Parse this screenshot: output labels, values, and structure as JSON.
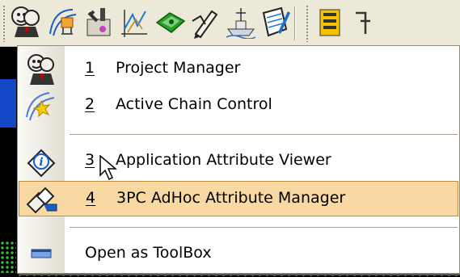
{
  "toolbar": {
    "buttons": [
      {
        "icon": "project-manager-icon"
      },
      {
        "icon": "chain-control-icon"
      },
      {
        "icon": "tools-icon"
      },
      {
        "icon": "graph-icon"
      },
      {
        "icon": "network-icon"
      },
      {
        "icon": "pencil-icon"
      },
      {
        "icon": "ship-icon"
      },
      {
        "icon": "notepad-icon"
      },
      {
        "icon": "toolbox-icon"
      }
    ]
  },
  "menu": {
    "items": [
      {
        "number": "1",
        "label": "Project Manager",
        "icon": "project-manager-icon"
      },
      {
        "number": "2",
        "label": "Active Chain Control",
        "icon": "chain-control-icon"
      },
      {
        "number": "3",
        "label": "Application Attribute Viewer",
        "icon": "info-icon"
      },
      {
        "number": "4",
        "label": "3PC AdHoc Attribute Manager",
        "icon": "attribute-manager-icon"
      },
      {
        "number": "",
        "label": "Open as ToolBox",
        "icon": "toolbox-icon"
      }
    ]
  },
  "colors": {
    "menu_highlight": "#f9d9a3",
    "menu_highlight_border": "#c08a40",
    "toolbar_bg": "#ece9d8"
  }
}
